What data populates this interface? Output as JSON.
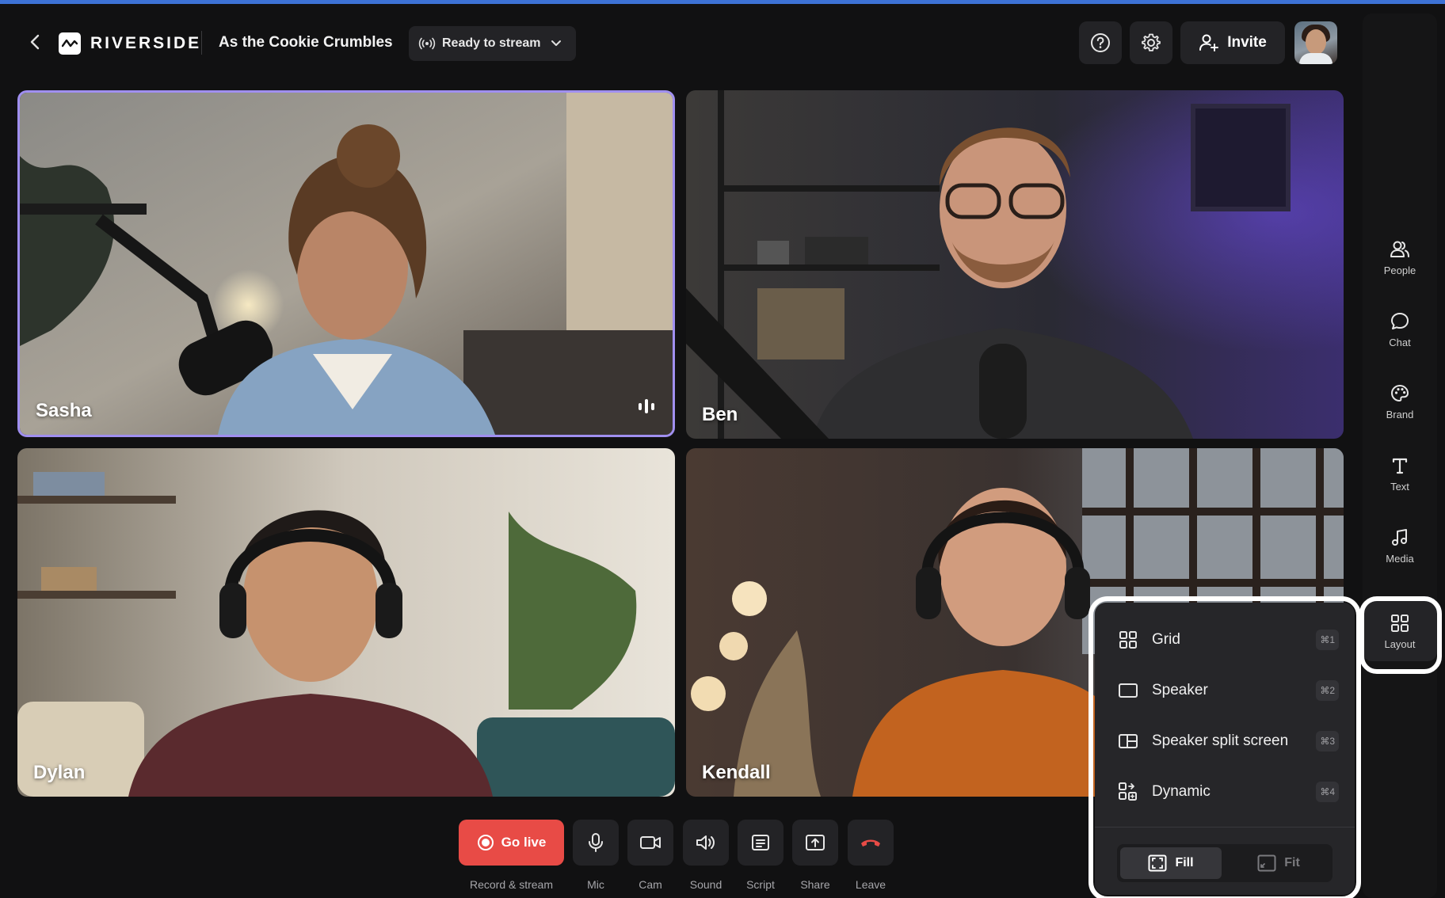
{
  "app": {
    "brand": "RIVERSIDE",
    "project_title": "As the Cookie Crumbles"
  },
  "header": {
    "stream_status": "Ready to stream",
    "invite_label": "Invite"
  },
  "participants": [
    {
      "name": "Sasha",
      "speaking": true
    },
    {
      "name": "Ben",
      "speaking": false
    },
    {
      "name": "Dylan",
      "speaking": false
    },
    {
      "name": "Kendall",
      "speaking": false
    }
  ],
  "sidebar": {
    "items": [
      {
        "label": "People",
        "icon": "people-icon"
      },
      {
        "label": "Chat",
        "icon": "chat-icon"
      },
      {
        "label": "Brand",
        "icon": "palette-icon"
      },
      {
        "label": "Text",
        "icon": "text-icon"
      },
      {
        "label": "Media",
        "icon": "music-icon"
      },
      {
        "label": "Layout",
        "icon": "layout-grid-icon",
        "active": true
      }
    ]
  },
  "layout_menu": {
    "options": [
      {
        "label": "Grid",
        "shortcut": "⌘1"
      },
      {
        "label": "Speaker",
        "shortcut": "⌘2"
      },
      {
        "label": "Speaker split screen",
        "shortcut": "⌘3"
      },
      {
        "label": "Dynamic",
        "shortcut": "⌘4"
      }
    ],
    "fit_options": [
      {
        "label": "Fill",
        "selected": true
      },
      {
        "label": "Fit",
        "selected": false
      }
    ]
  },
  "controls": {
    "go_live_label": "Go live",
    "record_label": "Record & stream",
    "buttons": [
      {
        "label": "Mic",
        "icon": "mic-icon"
      },
      {
        "label": "Cam",
        "icon": "camera-icon"
      },
      {
        "label": "Sound",
        "icon": "speaker-icon"
      },
      {
        "label": "Script",
        "icon": "script-icon"
      },
      {
        "label": "Share",
        "icon": "share-screen-icon"
      },
      {
        "label": "Leave",
        "icon": "hang-up-icon"
      }
    ]
  },
  "colors": {
    "accent_border": "#a08ff0",
    "go_live": "#e84b46",
    "leave": "#e84b46",
    "top_bar": "#3d72d6"
  }
}
